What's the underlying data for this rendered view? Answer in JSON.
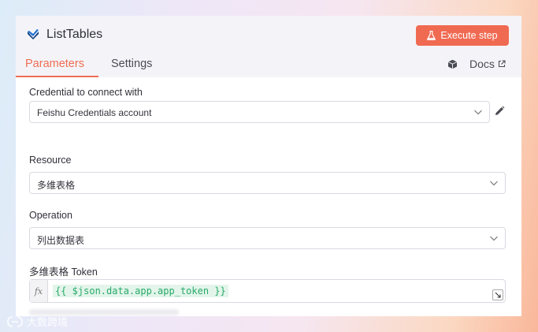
{
  "header": {
    "title": "ListTables",
    "execute_label": "Execute step",
    "accent_color": "#f06a52"
  },
  "tabs": {
    "parameters": "Parameters",
    "settings": "Settings",
    "docs": "Docs"
  },
  "fields": {
    "credential": {
      "label": "Credential to connect with",
      "value": "Feishu Credentials account"
    },
    "resource": {
      "label": "Resource",
      "value": "多维表格"
    },
    "operation": {
      "label": "Operation",
      "value": "列出数据表"
    },
    "token": {
      "label": "多维表格 Token",
      "fx": "fx",
      "expression": "{{ $json.data.app.app_token }}"
    }
  },
  "watermark": {
    "text": "大数跨境"
  },
  "icons": [
    "n8n-logo-icon",
    "flask-icon",
    "box-icon",
    "external-link-icon",
    "chevron-down-icon",
    "pencil-icon",
    "expand-icon"
  ]
}
